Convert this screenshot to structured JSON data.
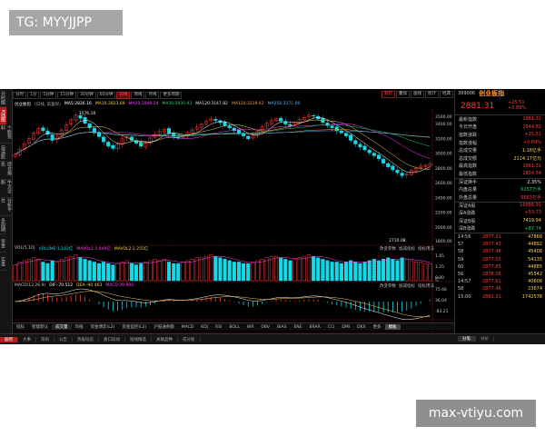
{
  "watermarks": {
    "top": "TG: MYYJJPP",
    "bottom": "max-vtiyu.com"
  },
  "colors": {
    "up": "#ff3a3a",
    "down": "#16d9e8",
    "accent": "#b41e1e"
  },
  "left_strip": [
    "分时图",
    "K线图",
    "个股资料",
    "自选股",
    "综合排名",
    "牛叉诊断",
    "分析平台",
    "多周期",
    "资金",
    "实盘"
  ],
  "toolbar": {
    "periods": [
      "分时",
      "1分",
      "5分钟",
      "15分钟",
      "30分钟",
      "60分钟",
      "日线",
      "周线",
      "月线",
      "更多周期"
    ],
    "active_period": "日线",
    "right": [
      "复权",
      "叠加",
      "画线",
      "统计",
      "经典"
    ]
  },
  "ma_legend": {
    "name": "创业板指",
    "prefix": "(日线, 前复权)",
    "items": [
      {
        "text": "MA5:2826.16",
        "color": "#ffffff"
      },
      {
        "text": "MA10:2823.69",
        "color": "#ffd24a"
      },
      {
        "text": "MA20:2848.24",
        "color": "#ff40ff"
      },
      {
        "text": "MA30:2930.93",
        "color": "#20d36a"
      },
      {
        "text": "MA120:3147.82",
        "color": "#e8e8e8"
      },
      {
        "text": "MA120:3219.42",
        "color": "#ffa040"
      },
      {
        "text": "MA250:3171.00",
        "color": "#40c0ff"
      }
    ]
  },
  "vol_legend": [
    {
      "text": "VOL(5,10)",
      "color": "#c8c8c8"
    },
    {
      "text": "VOLUME:1.182亿",
      "color": "#16d9e8"
    },
    {
      "text": "MAVOL1:1.449亿",
      "color": "#ff40ff"
    },
    {
      "text": "MAVOL2:1.255亿",
      "color": "#ffd24a"
    }
  ],
  "macd_legend": [
    {
      "text": "MACD(12,26,9)",
      "color": "#c8c8c8"
    },
    {
      "text": "DIF:-70.512",
      "color": "#ffffff"
    },
    {
      "text": "DEA:-90.463",
      "color": "#ffd24a"
    },
    {
      "text": "MACD:39.900",
      "color": "#ff40ff"
    }
  ],
  "sub_tools": [
    "改变参数",
    "加减指标",
    "指标用法"
  ],
  "indicator_tabs": {
    "items": [
      "指标",
      "智能默认",
      "成交量",
      "均线",
      "资金博弈(L2)",
      "资金监控(L2)",
      "沪股通余额",
      "MACD",
      "KDJ",
      "RSI",
      "BOLL",
      "WR",
      "OBV",
      "BIAS",
      "ENE",
      "BRAR",
      "CCI",
      "DMI",
      "DKX",
      "更多",
      "模板"
    ],
    "active": "成交量",
    "highlighted": "模板"
  },
  "bottom_bar": {
    "items": [
      "股吧",
      "大事",
      "资讯",
      "公告",
      "热股动态",
      "盘口异动",
      "短线精选",
      "关联品种",
      "成分股"
    ],
    "active": "股吧",
    "right": [
      "分笔",
      "分价"
    ],
    "right_active": "分笔"
  },
  "price_axis": [
    "3500.00",
    "3400.00",
    "3200.00",
    "3000.00",
    "2800.00",
    "2600.00",
    "2400.00",
    "2200.00",
    "2000.00",
    "1800.00"
  ],
  "vol_axis": [
    "1.85",
    "1.25",
    "0.80"
  ],
  "vol_unit": "亿",
  "macd_axis": [
    "75.46",
    "36.04",
    "-83.21"
  ],
  "time_axis": [
    "07",
    "08",
    "09",
    "10",
    "11",
    "12",
    "2022",
    "02",
    "03"
  ],
  "annotations": {
    "high": "3576.16",
    "low": "2710.08"
  },
  "panel": {
    "code": "399006",
    "name": "创业板指",
    "price": "2881.31",
    "change": "+25.51",
    "change_pct": "+0.89%",
    "rows": [
      {
        "label": "最新指数",
        "value": "2881.31",
        "color": "red"
      },
      {
        "label": "今日开盘",
        "value": "2844.82",
        "color": "red"
      },
      {
        "label": "指数涨跌",
        "value": "+25.51",
        "color": "red"
      },
      {
        "label": "指数涨幅",
        "value": "+0.89%",
        "color": "red"
      },
      {
        "label": "总成交量",
        "value": "1.18亿手",
        "color": "yellow"
      },
      {
        "label": "总成交额",
        "value": "2114.17亿元",
        "color": "yellow"
      },
      {
        "label": "最高指数",
        "value": "2881.31",
        "color": "red"
      },
      {
        "label": "最低指数",
        "value": "2834.54",
        "color": "red"
      },
      {
        "label": "深证换手",
        "value": "2.35%",
        "color": "white"
      },
      {
        "label": "内盘总量",
        "value": "6157万手",
        "color": "green"
      },
      {
        "label": "外盘总量",
        "value": "5663万手",
        "color": "red"
      },
      {
        "label": "深证A股",
        "value": "16886.91",
        "color": "red"
      },
      {
        "label": "深A涨跌",
        "value": "+53.73",
        "color": "red"
      },
      {
        "label": "深证B股",
        "value": "7419.94",
        "color": "yellow"
      },
      {
        "label": "深B涨跌",
        "value": "+87.74",
        "color": "green"
      }
    ],
    "ticks": [
      {
        "time": "14:56",
        "price": "2877.21",
        "vol": "47866"
      },
      {
        "time": "57",
        "price": "2877.43",
        "vol": "44892"
      },
      {
        "time": "58",
        "price": "2877.48",
        "vol": "45408"
      },
      {
        "time": "59",
        "price": "2877.55",
        "vol": "54135"
      },
      {
        "time": "60",
        "price": "2877.85",
        "vol": "44885"
      },
      {
        "time": "56",
        "price": "2878.06",
        "vol": "45542"
      },
      {
        "time": "14:57",
        "price": "2877.61",
        "vol": "40608"
      },
      {
        "time": "58",
        "price": "2877.46",
        "vol": "23674"
      },
      {
        "time": "15:00",
        "price": "2881.31",
        "vol": "1742578"
      }
    ]
  },
  "chart_data": {
    "type": "candlestick",
    "ylim": [
      1800,
      3600
    ],
    "annotations": [
      {
        "label": "3576.16",
        "kind": "high"
      },
      {
        "label": "2710.08",
        "kind": "low"
      }
    ],
    "close": [
      3010,
      3080,
      3150,
      3220,
      3300,
      3360,
      3330,
      3280,
      3200,
      3260,
      3340,
      3410,
      3480,
      3540,
      3500,
      3430,
      3370,
      3300,
      3250,
      3180,
      3120,
      3090,
      3150,
      3220,
      3250,
      3200,
      3160,
      3120,
      3170,
      3230,
      3280,
      3320,
      3350,
      3300,
      3250,
      3230,
      3260,
      3300,
      3340,
      3380,
      3420,
      3460,
      3490,
      3470,
      3440,
      3400,
      3370,
      3330,
      3300,
      3260,
      3220,
      3270,
      3320,
      3380,
      3430,
      3470,
      3490,
      3460,
      3420,
      3400,
      3440,
      3480,
      3510,
      3540,
      3530,
      3490,
      3440,
      3400,
      3370,
      3330,
      3300,
      3260,
      3200,
      3150,
      3110,
      3070,
      3030,
      2990,
      2950,
      2890,
      2840,
      2800,
      2760,
      2720,
      2740,
      2790,
      2820,
      2850,
      2860,
      2881
    ],
    "volume": [
      1.1,
      1.3,
      1.4,
      1.5,
      1.6,
      1.5,
      1.3,
      1.2,
      1.4,
      1.3,
      1.5,
      1.6,
      1.7,
      1.8,
      1.6,
      1.5,
      1.4,
      1.3,
      1.2,
      1.3,
      1.2,
      1.1,
      1.2,
      1.3,
      1.4,
      1.2,
      1.1,
      1.2,
      1.3,
      1.4,
      1.5,
      1.4,
      1.5,
      1.3,
      1.2,
      1.2,
      1.3,
      1.4,
      1.5,
      1.6,
      1.6,
      1.7,
      1.8,
      1.7,
      1.6,
      1.5,
      1.4,
      1.3,
      1.3,
      1.2,
      1.2,
      1.3,
      1.4,
      1.5,
      1.6,
      1.7,
      1.7,
      1.6,
      1.5,
      1.4,
      1.5,
      1.6,
      1.7,
      1.8,
      1.7,
      1.6,
      1.5,
      1.4,
      1.3,
      1.3,
      1.2,
      1.3,
      1.4,
      1.3,
      1.2,
      1.3,
      1.4,
      1.5,
      1.4,
      1.5,
      1.6,
      1.5,
      1.4,
      1.6,
      1.5,
      1.4,
      1.3,
      1.3,
      1.2,
      1.18
    ]
  }
}
